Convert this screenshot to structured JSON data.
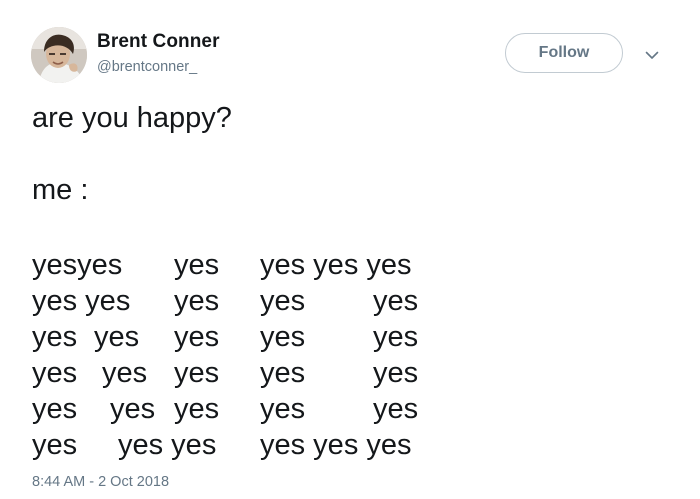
{
  "author": {
    "display_name": "Brent Conner",
    "handle": "@brentconner_",
    "avatar_icon": "profile-photo"
  },
  "actions": {
    "follow_label": "Follow",
    "menu_icon": "chevron-down-icon"
  },
  "tweet": {
    "line_question": "are you happy?",
    "line_me": "me :",
    "yes_rows": [
      [
        "yesyes",
        "yes",
        "yes yes yes"
      ],
      [
        "yes yes",
        "yes",
        "yes",
        "yes"
      ],
      [
        "yes",
        "yes",
        "yes",
        "yes",
        "yes"
      ],
      [
        "yes",
        "yes",
        "yes",
        "yes",
        "yes"
      ],
      [
        "yes",
        "yes",
        "yes",
        "yes",
        "yes"
      ],
      [
        "yes",
        "yes yes",
        "yes yes yes"
      ]
    ],
    "timestamp": "8:44 AM - 2 Oct 2018"
  },
  "colors": {
    "text": "#14171a",
    "secondary": "#657786",
    "button_border": "#c2cbd2"
  }
}
